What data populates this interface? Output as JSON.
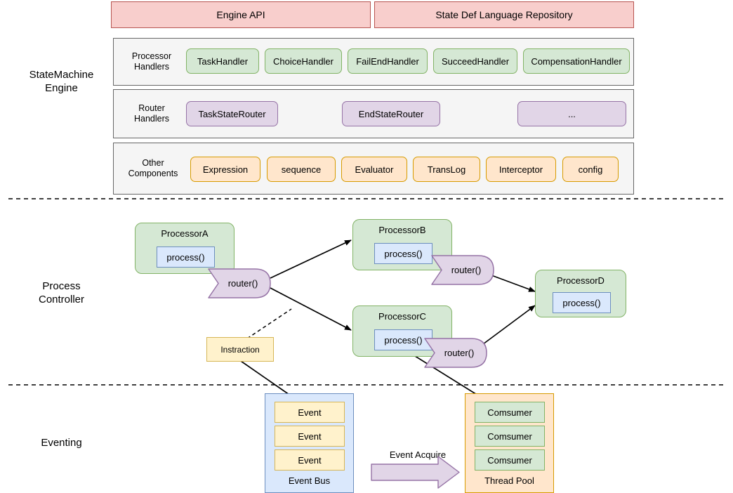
{
  "sections": [
    {
      "id": "statemachine-engine",
      "label": "StateMachine\nEngine"
    },
    {
      "id": "process-controller",
      "label": "Process\nController"
    },
    {
      "id": "eventing",
      "label": "Eventing"
    }
  ],
  "banners": [
    {
      "id": "engine-api",
      "label": "Engine API"
    },
    {
      "id": "state-def-language-repository",
      "label": "State Def Language Repository"
    }
  ],
  "engine_rows": [
    {
      "id": "processor-handlers",
      "title": "Processor\nHandlers",
      "style": "green",
      "items": [
        {
          "label": "TaskHandler"
        },
        {
          "label": "ChoiceHandler"
        },
        {
          "label": "FailEndHandler"
        },
        {
          "label": "SucceedHandler"
        },
        {
          "label": "CompensationHandler"
        }
      ]
    },
    {
      "id": "router-handlers",
      "title": "Router\nHandlers",
      "style": "purple",
      "items": [
        {
          "label": "TaskStateRouter"
        },
        {
          "label": "EndStateRouter"
        },
        {
          "label": "..."
        }
      ]
    },
    {
      "id": "other-components",
      "title": "Other\nComponents",
      "style": "orange",
      "items": [
        {
          "label": "Expression"
        },
        {
          "label": "sequence"
        },
        {
          "label": "Evaluator"
        },
        {
          "label": "TransLog"
        },
        {
          "label": "Interceptor"
        },
        {
          "label": "config"
        }
      ]
    }
  ],
  "processors": [
    {
      "id": "processor-a",
      "title": "ProcessorA",
      "method": "process()"
    },
    {
      "id": "processor-b",
      "title": "ProcessorB",
      "method": "process()"
    },
    {
      "id": "processor-c",
      "title": "ProcessorC",
      "method": "process()"
    },
    {
      "id": "processor-d",
      "title": "ProcessorD",
      "method": "process()"
    }
  ],
  "routers": [
    {
      "id": "router-a",
      "label": "router()"
    },
    {
      "id": "router-b",
      "label": "router()"
    },
    {
      "id": "router-c",
      "label": "router()"
    }
  ],
  "instraction": {
    "label": "Instraction"
  },
  "eventing": {
    "event_bus": {
      "caption": "Event Bus",
      "items": [
        {
          "label": "Event"
        },
        {
          "label": "Event"
        },
        {
          "label": "Event"
        }
      ]
    },
    "thread_pool": {
      "caption": "Thread Pool",
      "items": [
        {
          "label": "Comsumer"
        },
        {
          "label": "Comsumer"
        },
        {
          "label": "Comsumer"
        }
      ]
    },
    "acquire_label": "Event Acquire"
  },
  "colors": {
    "banner_fill": "#f8cecc",
    "banner_stroke": "#b85450",
    "green_fill": "#d5e8d4",
    "green_stroke": "#82b366",
    "purple_fill": "#e1d5e7",
    "purple_stroke": "#9673a6",
    "orange_fill": "#ffe6cc",
    "orange_stroke": "#d79b00",
    "blue_fill": "#dae8fc",
    "blue_stroke": "#6c8ebf",
    "yellow_fill": "#fff2cc",
    "yellow_stroke": "#d6b656",
    "panel_fill": "#f5f5f5",
    "panel_stroke": "#666666",
    "edge": "#000000"
  }
}
